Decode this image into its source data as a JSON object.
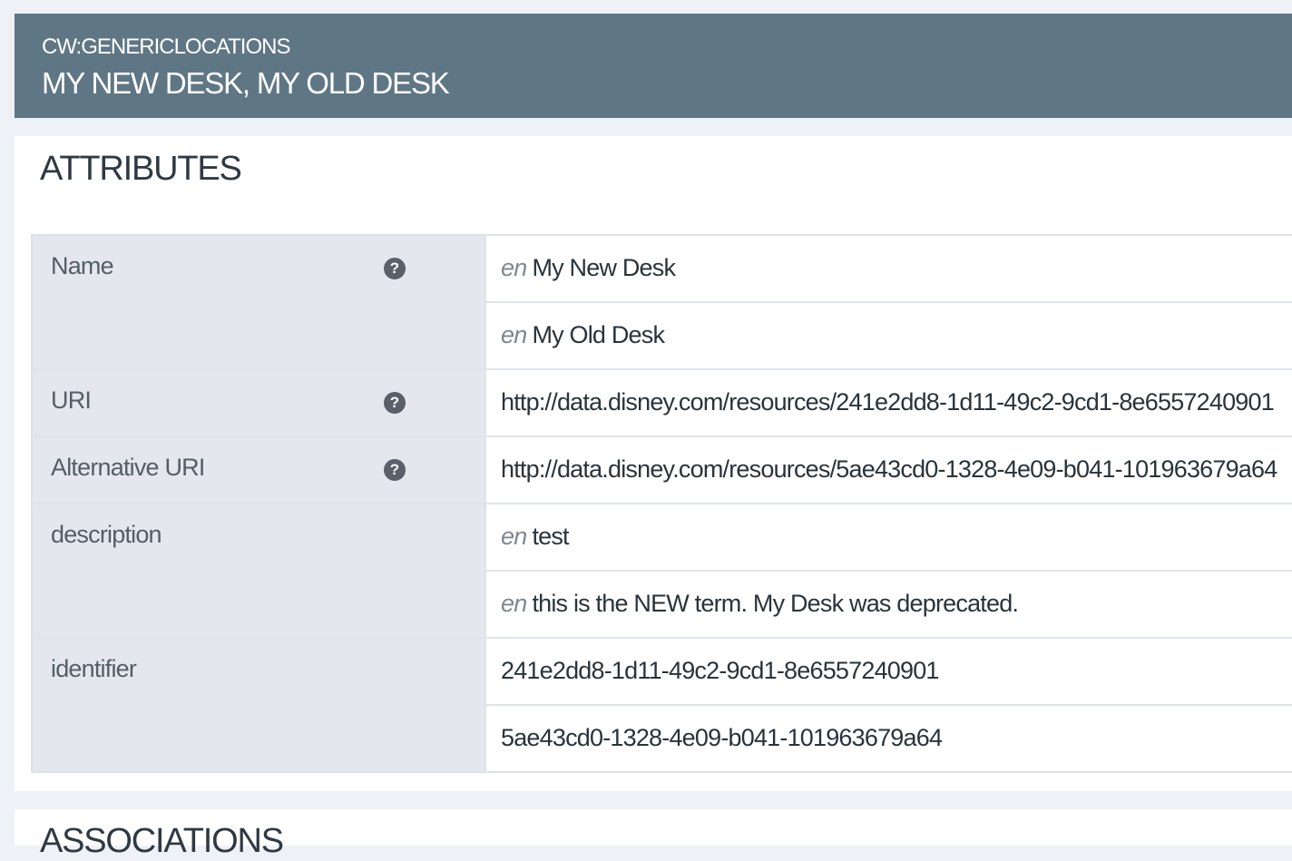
{
  "header": {
    "type_label": "CW:GENERICLOCATIONS",
    "title": "MY NEW DESK, MY OLD DESK"
  },
  "attributes": {
    "section_title": "ATTRIBUTES",
    "help_icon": "question-circle-icon",
    "rows": [
      {
        "label": "Name",
        "values": [
          {
            "lang": "en",
            "text": "My New Desk"
          },
          {
            "lang": "en",
            "text": "My Old Desk"
          }
        ]
      },
      {
        "label": "URI",
        "values": [
          {
            "text": "http://data.disney.com/resources/241e2dd8-1d11-49c2-9cd1-8e6557240901"
          }
        ]
      },
      {
        "label": "Alternative URI",
        "values": [
          {
            "text": "http://data.disney.com/resources/5ae43cd0-1328-4e09-b041-101963679a64"
          }
        ]
      },
      {
        "label": "description",
        "values": [
          {
            "lang": "en",
            "text": "test"
          },
          {
            "lang": "en",
            "text": "this is the NEW term. My Desk was deprecated."
          }
        ]
      },
      {
        "label": "identifier",
        "values": [
          {
            "text": "241e2dd8-1d11-49c2-9cd1-8e6557240901"
          },
          {
            "text": "5ae43cd0-1328-4e09-b041-101963679a64"
          }
        ]
      }
    ]
  },
  "associations": {
    "section_title": "ASSOCIATIONS"
  },
  "colors": {
    "header_bg": "#5f7685",
    "page_bg": "#eef1f6",
    "label_bg": "#e4e8ee"
  }
}
